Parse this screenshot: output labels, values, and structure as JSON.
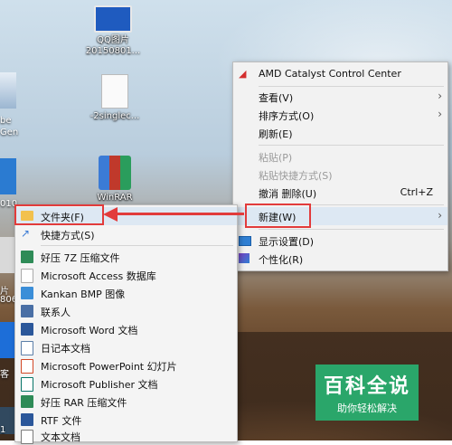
{
  "desktop": {
    "icons": [
      {
        "label1": "QQ图片",
        "label2": "20150801..."
      },
      {
        "label1": "",
        "label2": "-2singlec..."
      },
      {
        "label1": "WinRAR",
        "label2": ""
      }
    ],
    "left_labels": [
      "be",
      "Gen",
      "010",
      "片",
      "806",
      "客",
      "1"
    ]
  },
  "context_menu": {
    "items": [
      {
        "label": "AMD Catalyst Control Center",
        "icon": "amd-icon"
      },
      {
        "label": "查看(V)",
        "arrow": "›"
      },
      {
        "label": "排序方式(O)",
        "arrow": "›"
      },
      {
        "label": "刷新(E)"
      },
      {
        "label": "粘贴(P)",
        "disabled": true
      },
      {
        "label": "粘贴快捷方式(S)",
        "disabled": true
      },
      {
        "label": "撤消 删除(U)",
        "shortcut": "Ctrl+Z"
      },
      {
        "label": "新建(W)",
        "arrow": "›"
      },
      {
        "label": "显示设置(D)",
        "icon": "display-icon"
      },
      {
        "label": "个性化(R)",
        "icon": "personalize-icon"
      }
    ]
  },
  "new_submenu": {
    "items": [
      {
        "label": "文件夹(F)",
        "icon": "folder-icon",
        "color": "#f2c14e"
      },
      {
        "label": "快捷方式(S)",
        "icon": "shortcut-icon",
        "color": "#3a7bd5"
      },
      {
        "label": "好压 7Z 压缩文件",
        "icon": "archive-icon",
        "color": "#2e8b57"
      },
      {
        "label": "Microsoft Access 数据库",
        "icon": "access-icon",
        "color": "#a4373a"
      },
      {
        "label": "Kankan BMP 图像",
        "icon": "image-icon",
        "color": "#3b8ed8"
      },
      {
        "label": "联系人",
        "icon": "contact-icon",
        "color": "#4a6fa5"
      },
      {
        "label": "Microsoft Word 文档",
        "icon": "word-icon",
        "color": "#2b579a"
      },
      {
        "label": "日记本文档",
        "icon": "journal-icon",
        "color": "#5c7fa8"
      },
      {
        "label": "Microsoft PowerPoint 幻灯片",
        "icon": "powerpoint-icon",
        "color": "#d24726"
      },
      {
        "label": "Microsoft Publisher 文档",
        "icon": "publisher-icon",
        "color": "#077568"
      },
      {
        "label": "好压 RAR 压缩文件",
        "icon": "archive-icon",
        "color": "#2e8b57"
      },
      {
        "label": "RTF 文件",
        "icon": "rtf-icon",
        "color": "#2b579a"
      },
      {
        "label": "文本文档",
        "icon": "text-icon",
        "color": "#7a7a7a"
      }
    ]
  },
  "watermark": {
    "title": "百科全说",
    "subtitle": "助你轻松解决"
  },
  "accent_color": "#e23b3b"
}
